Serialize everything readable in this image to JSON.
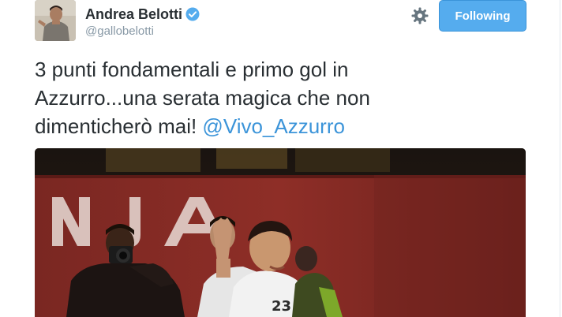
{
  "author": {
    "display_name": "Andrea Belotti",
    "handle": "@gallobelotti",
    "verified": true,
    "avatar_icon": "profile-photo"
  },
  "actions": {
    "settings_icon": "gear-icon",
    "follow_label": "Following",
    "follow_color": "#55acee"
  },
  "tweet": {
    "line1": "3 punti fondamentali e primo gol in",
    "line2": "Azzurro...una serata magica che non",
    "line3_text": "dimenticherò mai! ",
    "mention": "@Vivo_Azzurro",
    "mention_color": "#3b94d9"
  },
  "media": {
    "type": "photo",
    "banner_letters": "NJA",
    "jersey_number": "23"
  }
}
